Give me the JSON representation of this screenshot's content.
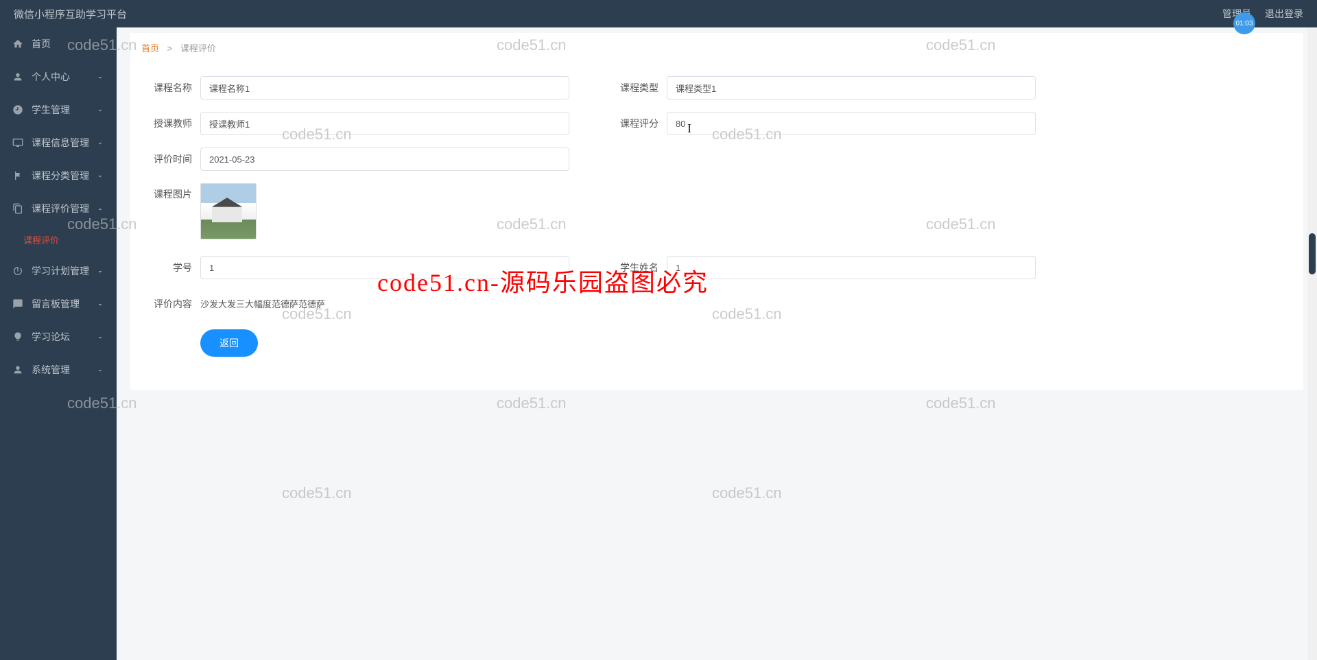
{
  "header": {
    "title": "微信小程序互助学习平台",
    "admin_link": "管理员",
    "logout_link": "退出登录",
    "timer": "01:03"
  },
  "sidebar": {
    "items": [
      {
        "label": "首页",
        "icon": "home"
      },
      {
        "label": "个人中心",
        "icon": "person",
        "expandable": true
      },
      {
        "label": "学生管理",
        "icon": "clock",
        "expandable": true
      },
      {
        "label": "课程信息管理",
        "icon": "monitor",
        "expandable": true
      },
      {
        "label": "课程分类管理",
        "icon": "flag",
        "expandable": true
      },
      {
        "label": "课程评价管理",
        "icon": "copy",
        "expandable": true,
        "expanded": true
      },
      {
        "label": "学习计划管理",
        "icon": "power",
        "expandable": true
      },
      {
        "label": "留言板管理",
        "icon": "message",
        "expandable": true
      },
      {
        "label": "学习论坛",
        "icon": "bulb",
        "expandable": true
      },
      {
        "label": "系统管理",
        "icon": "person",
        "expandable": true
      }
    ],
    "submenu_active": "课程评价"
  },
  "breadcrumb": {
    "home": "首页",
    "sep": ">",
    "current": "课程评价"
  },
  "form": {
    "course_name_label": "课程名称",
    "course_name_value": "课程名称1",
    "course_type_label": "课程类型",
    "course_type_value": "课程类型1",
    "teacher_label": "授课教师",
    "teacher_value": "授课教师1",
    "score_label": "课程评分",
    "score_value": "80",
    "eval_time_label": "评价时间",
    "eval_time_value": "2021-05-23",
    "course_image_label": "课程图片",
    "student_id_label": "学号",
    "student_id_value": "1",
    "student_name_label": "学生姓名",
    "student_name_value": "1",
    "eval_content_label": "评价内容",
    "eval_content_value": "沙发大发三大幅度范德萨范德萨",
    "back_button": "返回"
  },
  "watermarks": {
    "gray": "code51.cn",
    "red": "code51.cn-源码乐园盗图必究"
  }
}
